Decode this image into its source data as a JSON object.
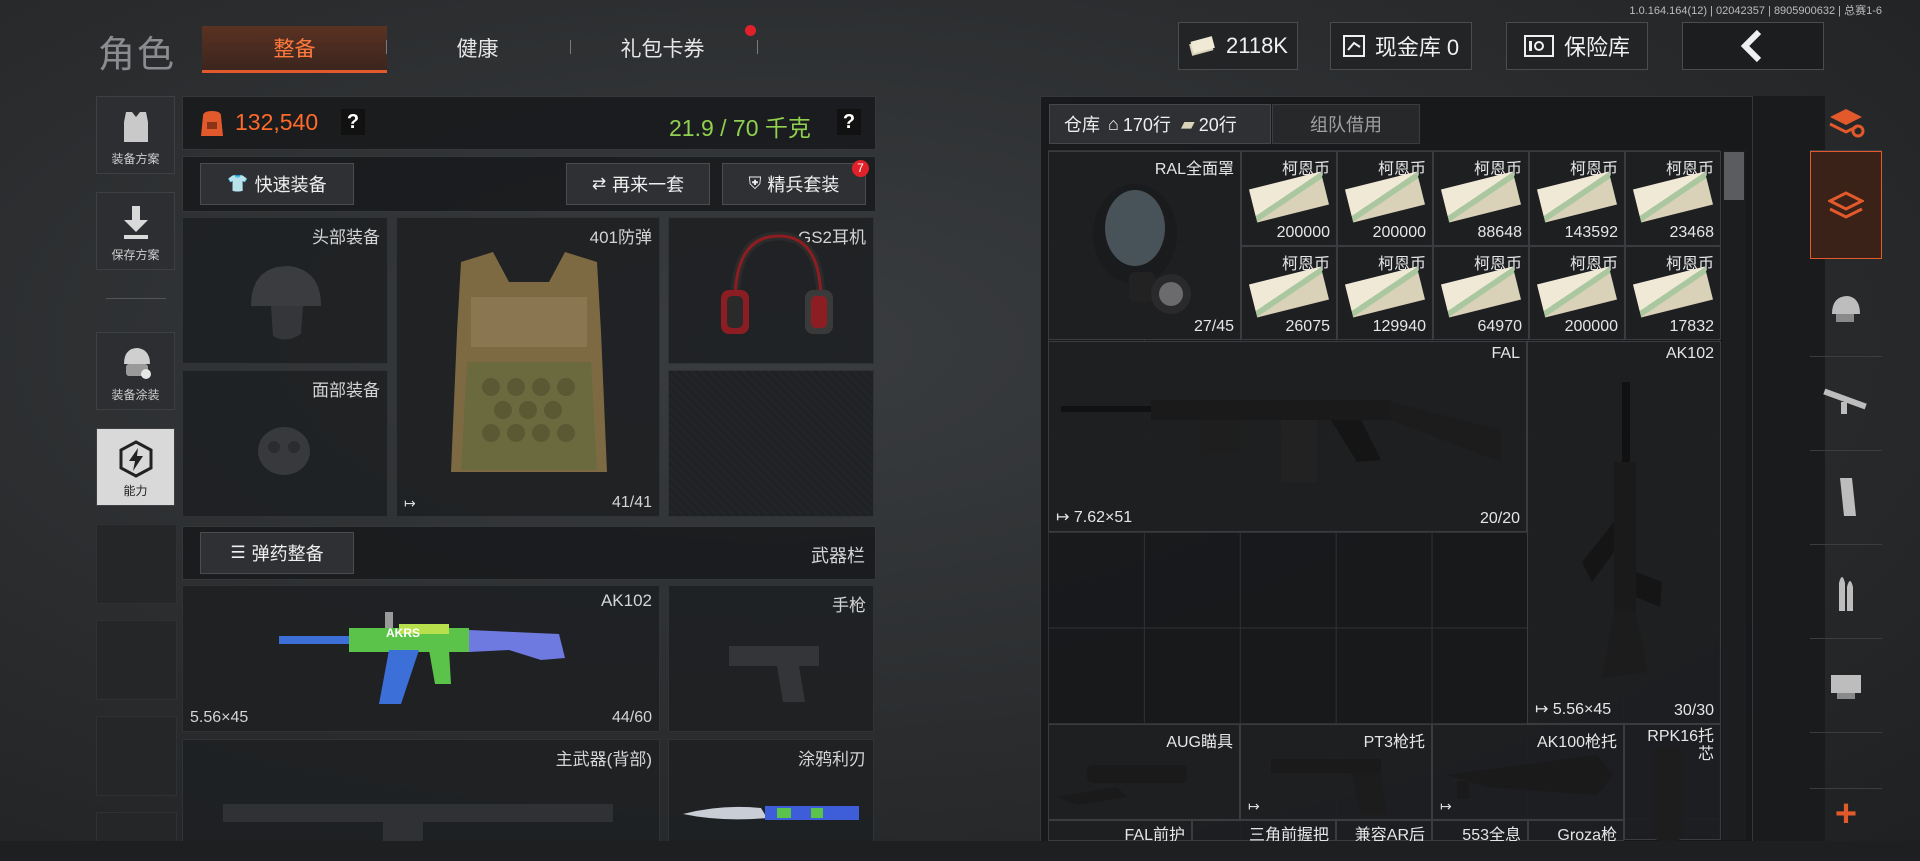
{
  "version": "1.0.164.164(12) | 02042357 | 8905900632 | 总赛1-6",
  "title": "角色",
  "tabs": [
    {
      "label": "整备",
      "active": true
    },
    {
      "label": "健康",
      "active": false
    },
    {
      "label": "礼包卡券",
      "active": false,
      "notify": true
    }
  ],
  "header": {
    "money": "2118K",
    "cash_vault": "现金库 0",
    "safe": "保险库"
  },
  "left_menu": [
    {
      "label": "装备方案",
      "icon": "vest-icon"
    },
    {
      "label": "保存方案",
      "icon": "download-icon"
    },
    {
      "label": "装备涂装",
      "icon": "painted-helmet-icon"
    },
    {
      "label": "能力",
      "icon": "ability-icon"
    }
  ],
  "loadout": {
    "value": "132,540",
    "weight": "21.9 / 70 千克",
    "help": "?",
    "quick_equip": "快速装备",
    "again": "再来一套",
    "elite": "精兵套装",
    "elite_badge": "7",
    "slots": {
      "head": "头部装备",
      "face": "面部装备",
      "armor": {
        "name": "401防弹",
        "count": "41/41"
      },
      "headset": "GS2耳机"
    },
    "ammo_btn": "弹药整备",
    "weapon_bar": "武器栏",
    "primary": {
      "name": "AK102",
      "ammo": "5.56×45",
      "count": "44/60",
      "decal": "AKRS"
    },
    "pistol": "手枪",
    "back_weapon": "主武器(背部)",
    "melee": "涂鸦利刃"
  },
  "warehouse": {
    "tab_label": "仓库",
    "rows_home": "170行",
    "rows_ticket": "20行",
    "team_borrow": "组队借用",
    "mask": {
      "name": "RAL全面罩",
      "count": "27/45"
    },
    "coin_name": "柯恩币",
    "coins": [
      "200000",
      "200000",
      "88648",
      "143592",
      "23468",
      "26075",
      "129940",
      "64970",
      "200000",
      "17832"
    ],
    "fal": {
      "name": "FAL",
      "ammo": "7.62×51",
      "count": "20/20"
    },
    "ak102": {
      "name": "AK102",
      "ammo": "5.56×45",
      "count": "30/30"
    },
    "attachments": [
      "AUG瞄具",
      "PT3枪托",
      "AK100枪托",
      "RPK16托芯"
    ],
    "bottom_row": [
      "FAL前护",
      "三角前握把",
      "兼容AR后",
      "553全息",
      "Groza枪"
    ],
    "plus": "+"
  },
  "colors": {
    "accent": "#e2592b",
    "weight": "#8fd14f",
    "value": "#ff6a2a"
  }
}
